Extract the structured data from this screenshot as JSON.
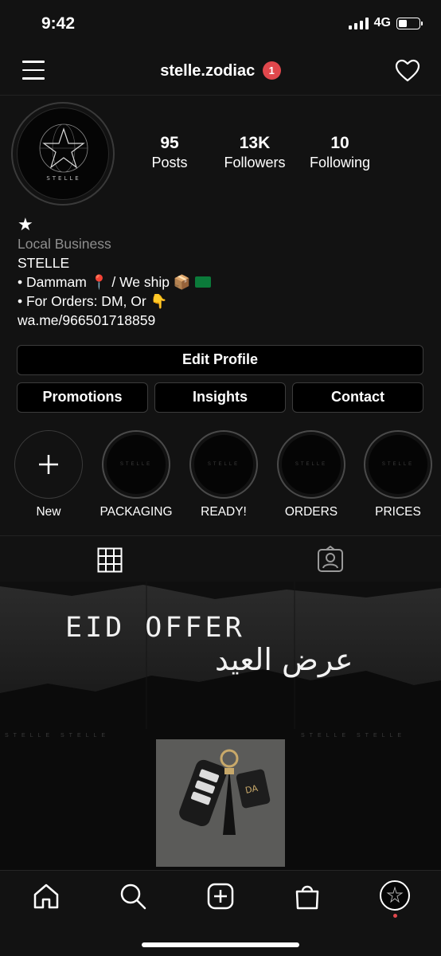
{
  "status": {
    "time": "9:42",
    "network": "4G"
  },
  "header": {
    "username": "stelle.zodiac",
    "notification_count": "1"
  },
  "profile": {
    "stats": [
      {
        "value": "95",
        "label": "Posts"
      },
      {
        "value": "13K",
        "label": "Followers"
      },
      {
        "value": "10",
        "label": "Following"
      }
    ],
    "bio": {
      "star": "★",
      "category": "Local Business",
      "name": "STELLE",
      "line1_a": "• Dammam",
      "line1_b": " / We ship",
      "line2": "• For Orders: DM, Or",
      "link": "wa.me/966501718859"
    }
  },
  "buttons": {
    "edit_profile": "Edit Profile",
    "promotions": "Promotions",
    "insights": "Insights",
    "contact": "Contact"
  },
  "highlights": [
    {
      "label": "New"
    },
    {
      "label": "PACKAGING",
      "cover": "STELLE"
    },
    {
      "label": "READY!",
      "cover": "STELLE"
    },
    {
      "label": "ORDERS",
      "cover": "STELLE"
    },
    {
      "label": "PRICES",
      "cover": "STELLE"
    }
  ],
  "post": {
    "title_en": "EID OFFER",
    "title_ar": "عرض العيد",
    "strip_text": "STELLE STELLE"
  },
  "colors": {
    "background": "#121212",
    "badge": "#e0474c",
    "muted": "#8e8e8e"
  }
}
